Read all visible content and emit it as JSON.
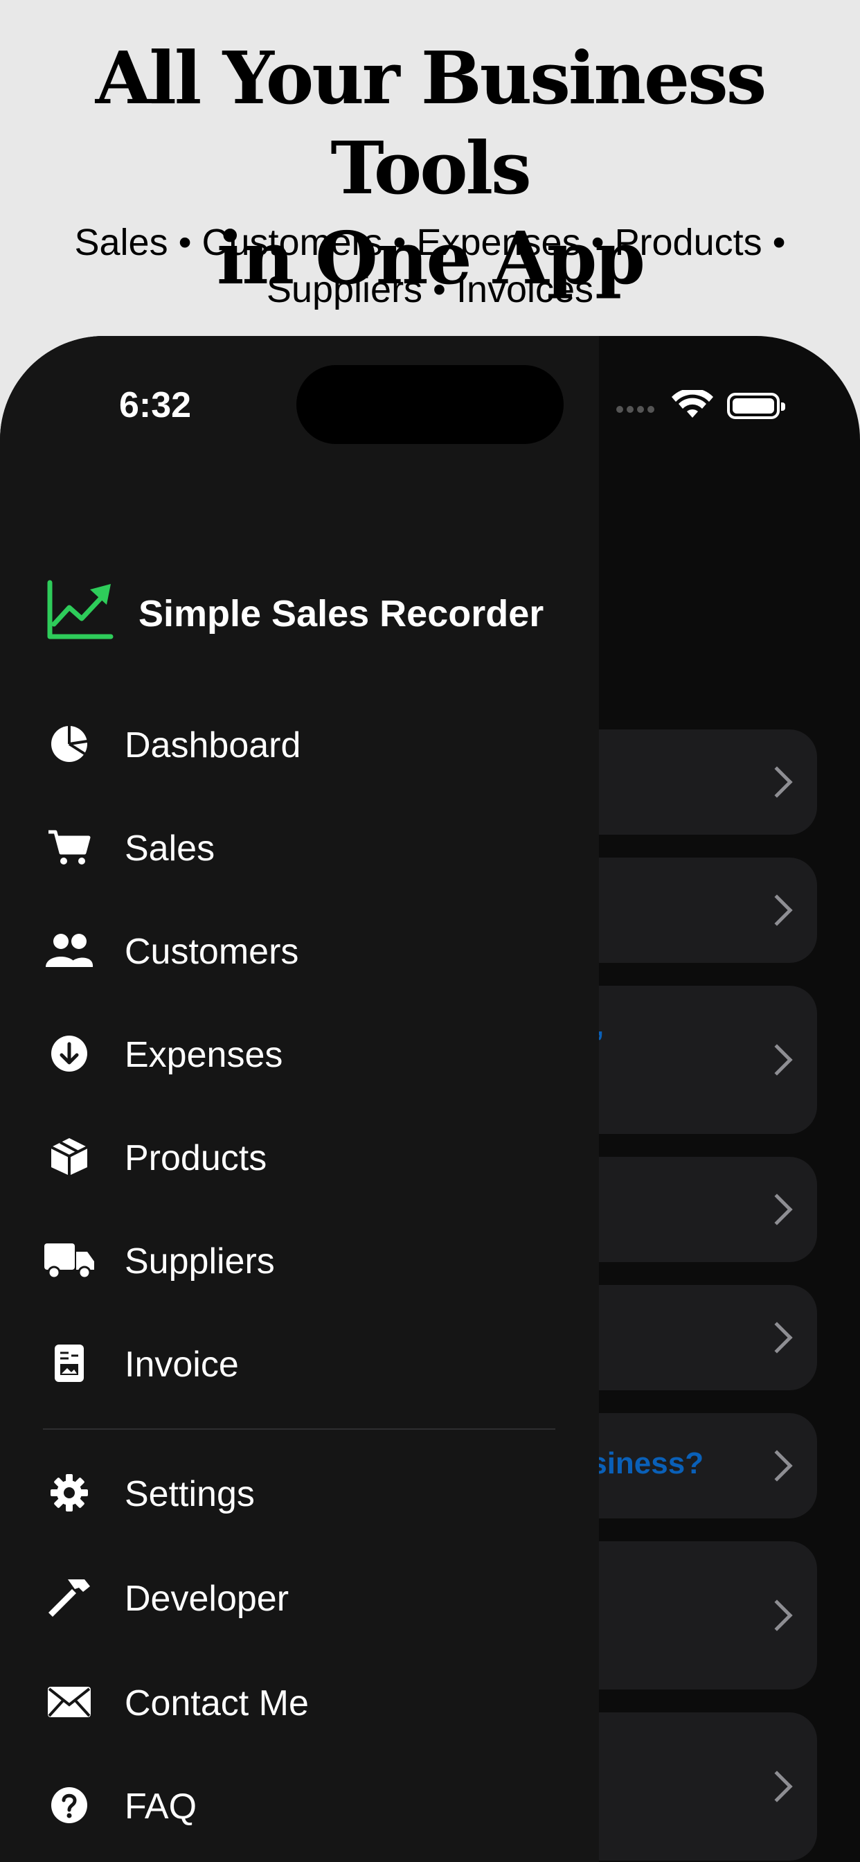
{
  "promo": {
    "headline_line1": "All Your Business Tools",
    "headline_line2": "in One App",
    "subline_line1": "Sales • Customers • Expenses • Products •",
    "subline_line2": "Suppliers • Invoices"
  },
  "status_bar": {
    "time": "6:32"
  },
  "drawer": {
    "app_name": "Simple Sales Recorder",
    "brand_color": "#2ecc5a",
    "items": [
      {
        "label": "Dashboard",
        "icon": "pie-chart-icon"
      },
      {
        "label": "Sales",
        "icon": "cart-icon"
      },
      {
        "label": "Customers",
        "icon": "people-icon"
      },
      {
        "label": "Expenses",
        "icon": "arrow-down-circle-icon"
      },
      {
        "label": "Products",
        "icon": "box-icon"
      },
      {
        "label": "Suppliers",
        "icon": "truck-icon"
      },
      {
        "label": "Invoice",
        "icon": "invoice-icon"
      }
    ],
    "secondary_items": [
      {
        "label": "Settings",
        "icon": "gear-icon"
      },
      {
        "label": "Developer",
        "icon": "hammer-icon"
      },
      {
        "label": "Contact Me",
        "icon": "envelope-icon"
      },
      {
        "label": "FAQ",
        "icon": "question-circle-icon"
      }
    ]
  },
  "background": {
    "partial_link_1": "’",
    "partial_link_2": "isiness?",
    "link_color": "#0a60b8"
  }
}
